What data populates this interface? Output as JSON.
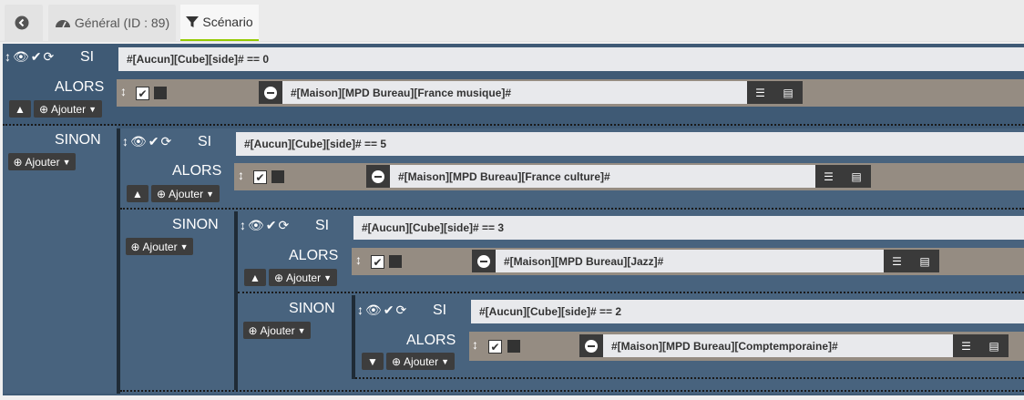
{
  "tabs": {
    "back_icon": "arrow-left-circle-icon",
    "general": "Général (ID : 89)",
    "scenario": "Scénario"
  },
  "labels": {
    "si": "SI",
    "alors": "ALORS",
    "sinon": "SINON",
    "ajouter": "Ajouter"
  },
  "colors": {
    "block": "#48637e",
    "action_row": "#958c82",
    "condition_bg": "#e8e9ec",
    "active_tab": "#94ca02"
  },
  "conditions": [
    {
      "expr": "#[Aucun][Cube][side]# == 0"
    },
    {
      "expr": "#[Aucun][Cube][side]# == 5"
    },
    {
      "expr": "#[Aucun][Cube][side]# == 3"
    },
    {
      "expr": "#[Aucun][Cube][side]# == 2"
    }
  ],
  "actions": [
    {
      "cmd": "#[Maison][MPD Bureau][France musique]#"
    },
    {
      "cmd": "#[Maison][MPD Bureau][France culture]#"
    },
    {
      "cmd": "#[Maison][MPD Bureau][Jazz]#"
    },
    {
      "cmd": "#[Maison][MPD Bureau][Comptemporaine]#"
    }
  ]
}
